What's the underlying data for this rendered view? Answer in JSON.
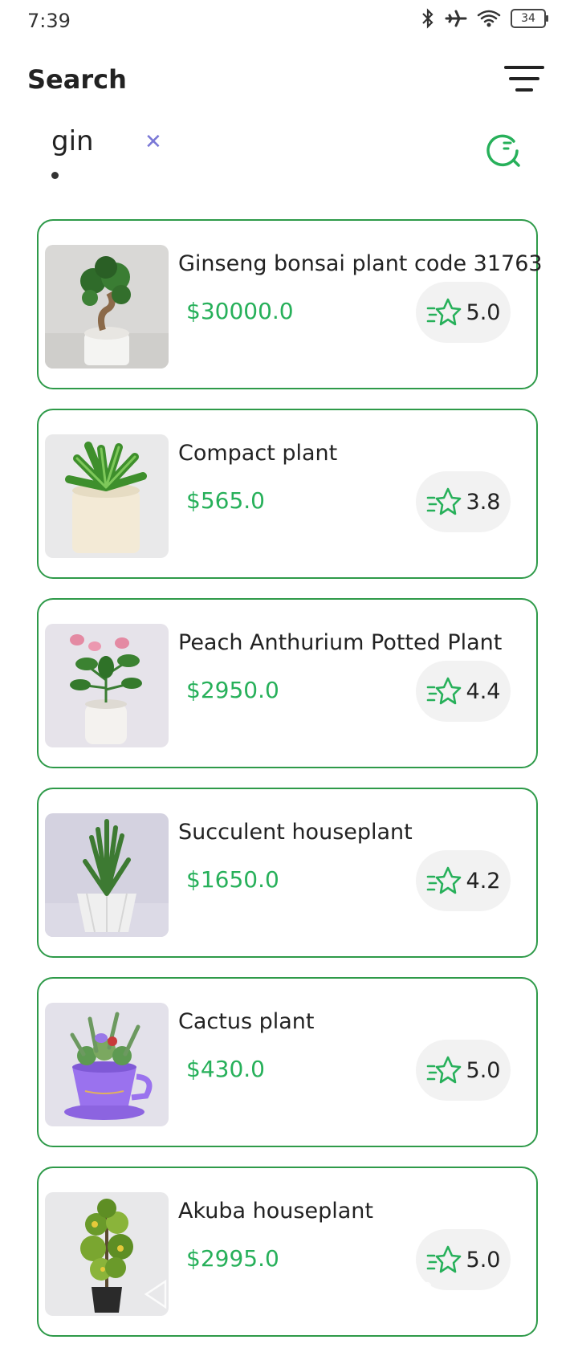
{
  "status": {
    "time": "7:39",
    "battery": "34"
  },
  "header": {
    "title": "Search"
  },
  "search": {
    "query": "gin"
  },
  "colors": {
    "accent": "#27b05a",
    "card_border": "#2e9a49",
    "clear_icon": "#7a78d6"
  },
  "products": [
    {
      "name": "Ginseng bonsai plant code 31763",
      "price": "$30000.0",
      "rating": "5.0"
    },
    {
      "name": "Compact plant",
      "price": "$565.0",
      "rating": "3.8"
    },
    {
      "name": "Peach Anthurium Potted Plant",
      "price": "$2950.0",
      "rating": "4.4"
    },
    {
      "name": "Succulent houseplant",
      "price": "$1650.0",
      "rating": "4.2"
    },
    {
      "name": "Cactus plant",
      "price": "$430.0",
      "rating": "5.0"
    },
    {
      "name": "Akuba houseplant",
      "price": "$2995.0",
      "rating": "5.0"
    }
  ]
}
